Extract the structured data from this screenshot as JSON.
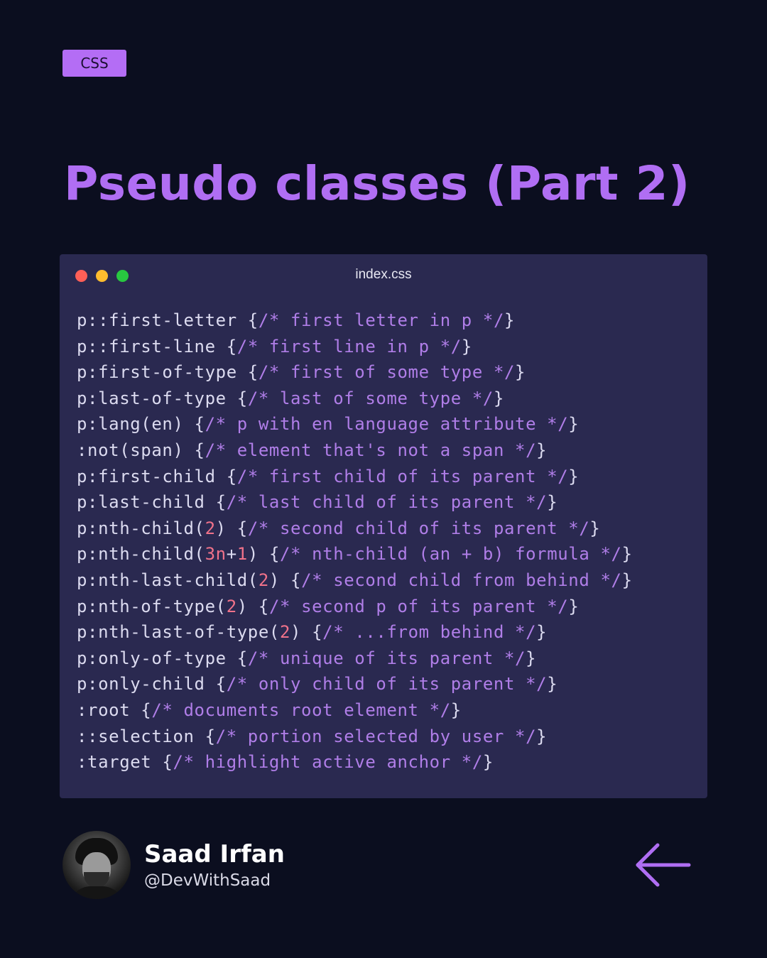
{
  "tag": "CSS",
  "title": "Pseudo classes (Part 2)",
  "window": {
    "filename": "index.css",
    "lines": [
      [
        {
          "t": "sel",
          "v": "p::first-letter "
        },
        {
          "t": "brace",
          "v": "{"
        },
        {
          "t": "comment",
          "v": "/* first letter in p */"
        },
        {
          "t": "brace",
          "v": "}"
        }
      ],
      [
        {
          "t": "sel",
          "v": "p::first-line "
        },
        {
          "t": "brace",
          "v": "{"
        },
        {
          "t": "comment",
          "v": "/* first line in p */"
        },
        {
          "t": "brace",
          "v": "}"
        }
      ],
      [
        {
          "t": "sel",
          "v": "p:first-of-type "
        },
        {
          "t": "brace",
          "v": "{"
        },
        {
          "t": "comment",
          "v": "/* first of some type */"
        },
        {
          "t": "brace",
          "v": "}"
        }
      ],
      [
        {
          "t": "sel",
          "v": "p:last-of-type "
        },
        {
          "t": "brace",
          "v": "{"
        },
        {
          "t": "comment",
          "v": "/* last of some type */"
        },
        {
          "t": "brace",
          "v": "}"
        }
      ],
      [
        {
          "t": "sel",
          "v": "p:lang(en) "
        },
        {
          "t": "brace",
          "v": "{"
        },
        {
          "t": "comment",
          "v": "/* p with en language attribute */"
        },
        {
          "t": "brace",
          "v": "}"
        }
      ],
      [
        {
          "t": "sel",
          "v": ":not(span) "
        },
        {
          "t": "brace",
          "v": "{"
        },
        {
          "t": "comment",
          "v": "/* element that's not a span */"
        },
        {
          "t": "brace",
          "v": "}"
        }
      ],
      [
        {
          "t": "sel",
          "v": "p:first-child "
        },
        {
          "t": "brace",
          "v": "{"
        },
        {
          "t": "comment",
          "v": "/* first child of its parent */"
        },
        {
          "t": "brace",
          "v": "}"
        }
      ],
      [
        {
          "t": "sel",
          "v": "p:last-child "
        },
        {
          "t": "brace",
          "v": "{"
        },
        {
          "t": "comment",
          "v": "/* last child of its parent */"
        },
        {
          "t": "brace",
          "v": "}"
        }
      ],
      [
        {
          "t": "sel",
          "v": "p:nth-child("
        },
        {
          "t": "num",
          "v": "2"
        },
        {
          "t": "sel",
          "v": ") "
        },
        {
          "t": "brace",
          "v": "{"
        },
        {
          "t": "comment",
          "v": "/* second child of its parent */"
        },
        {
          "t": "brace",
          "v": "}"
        }
      ],
      [
        {
          "t": "sel",
          "v": "p:nth-child("
        },
        {
          "t": "num",
          "v": "3n"
        },
        {
          "t": "sel",
          "v": "+"
        },
        {
          "t": "num",
          "v": "1"
        },
        {
          "t": "sel",
          "v": ") "
        },
        {
          "t": "brace",
          "v": "{"
        },
        {
          "t": "comment",
          "v": "/* nth-child (an + b) formula */"
        },
        {
          "t": "brace",
          "v": "}"
        }
      ],
      [
        {
          "t": "sel",
          "v": "p:nth-last-child("
        },
        {
          "t": "num",
          "v": "2"
        },
        {
          "t": "sel",
          "v": ") "
        },
        {
          "t": "brace",
          "v": "{"
        },
        {
          "t": "comment",
          "v": "/* second child from behind */"
        },
        {
          "t": "brace",
          "v": "}"
        }
      ],
      [
        {
          "t": "sel",
          "v": "p:nth-of-type("
        },
        {
          "t": "num",
          "v": "2"
        },
        {
          "t": "sel",
          "v": ") "
        },
        {
          "t": "brace",
          "v": "{"
        },
        {
          "t": "comment",
          "v": "/* second p of its parent */"
        },
        {
          "t": "brace",
          "v": "}"
        }
      ],
      [
        {
          "t": "sel",
          "v": "p:nth-last-of-type("
        },
        {
          "t": "num",
          "v": "2"
        },
        {
          "t": "sel",
          "v": ") "
        },
        {
          "t": "brace",
          "v": "{"
        },
        {
          "t": "comment",
          "v": "/* ...from behind */"
        },
        {
          "t": "brace",
          "v": "}"
        }
      ],
      [
        {
          "t": "sel",
          "v": "p:only-of-type "
        },
        {
          "t": "brace",
          "v": "{"
        },
        {
          "t": "comment",
          "v": "/* unique of its parent */"
        },
        {
          "t": "brace",
          "v": "}"
        }
      ],
      [
        {
          "t": "sel",
          "v": "p:only-child "
        },
        {
          "t": "brace",
          "v": "{"
        },
        {
          "t": "comment",
          "v": "/* only child of its parent */"
        },
        {
          "t": "brace",
          "v": "}"
        }
      ],
      [
        {
          "t": "sel",
          "v": ":root "
        },
        {
          "t": "brace",
          "v": "{"
        },
        {
          "t": "comment",
          "v": "/* documents root element */"
        },
        {
          "t": "brace",
          "v": "}"
        }
      ],
      [
        {
          "t": "sel",
          "v": "::selection "
        },
        {
          "t": "brace",
          "v": "{"
        },
        {
          "t": "comment",
          "v": "/* portion selected by user */"
        },
        {
          "t": "brace",
          "v": "}"
        }
      ],
      [
        {
          "t": "sel",
          "v": ":target "
        },
        {
          "t": "brace",
          "v": "{"
        },
        {
          "t": "comment",
          "v": "/* highlight active anchor */"
        },
        {
          "t": "brace",
          "v": "}"
        }
      ]
    ]
  },
  "author": {
    "name": "Saad Irfan",
    "handle": "@DevWithSaad"
  },
  "icons": {
    "window_controls": [
      "close-dot-icon",
      "minimize-dot-icon",
      "maximize-dot-icon"
    ],
    "nav": "arrow-left-icon"
  },
  "colors": {
    "background": "#0b0e1f",
    "accent": "#b06ef3",
    "window": "#2a2950",
    "code_text": "#dcdbf0",
    "code_comment": "#b07ee8",
    "code_number": "#f0728a"
  }
}
